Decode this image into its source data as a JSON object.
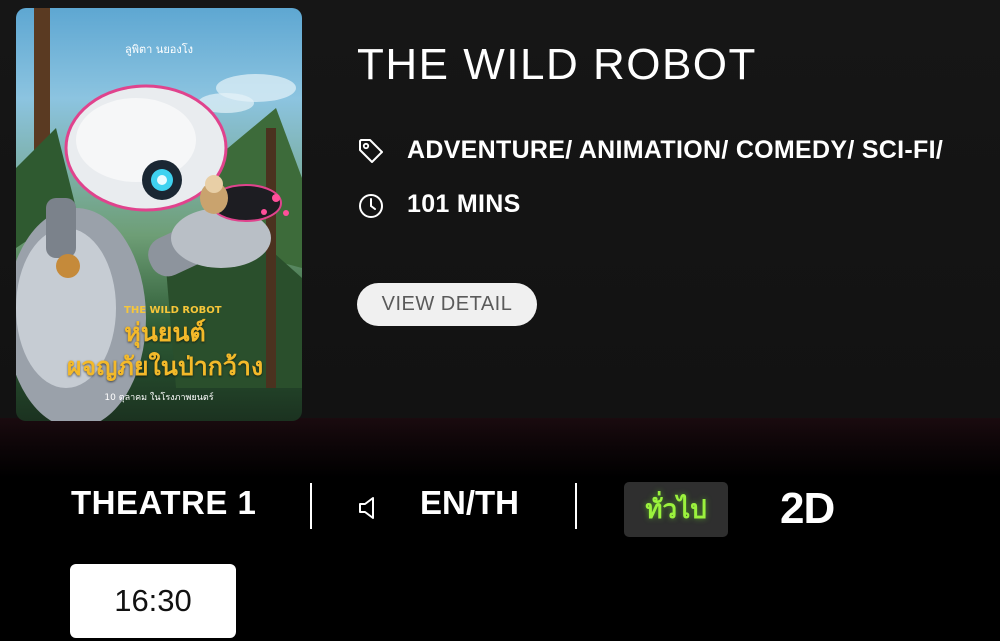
{
  "movie": {
    "title": "THE WILD ROBOT",
    "genres": "ADVENTURE/ ANIMATION/ COMEDY/ SCI-FI/",
    "duration": "101 MINS",
    "view_detail_label": "VIEW DETAIL",
    "genre_icon": "tag-icon",
    "duration_icon": "clock-icon"
  },
  "poster": {
    "credit_text": "ลูพิตา นยองโง",
    "title_en": "THE WILD ROBOT",
    "title_th_line1": "หุ่นยนต์",
    "title_th_line2": "ผจญภัยในป่ากว้าง",
    "release_text": "10 ตุลาคม ในโรงภาพยนตร์"
  },
  "showing": {
    "theatre": "THEATRE 1",
    "audio_icon": "speaker-icon",
    "audio": "EN/TH",
    "rating": "ทั่วไป",
    "format": "2D",
    "showtime": "16:30"
  },
  "colors": {
    "background": "#000000",
    "panel": "#141414",
    "rating_text": "#9bf23d",
    "button_bg": "#f0f0f0"
  }
}
